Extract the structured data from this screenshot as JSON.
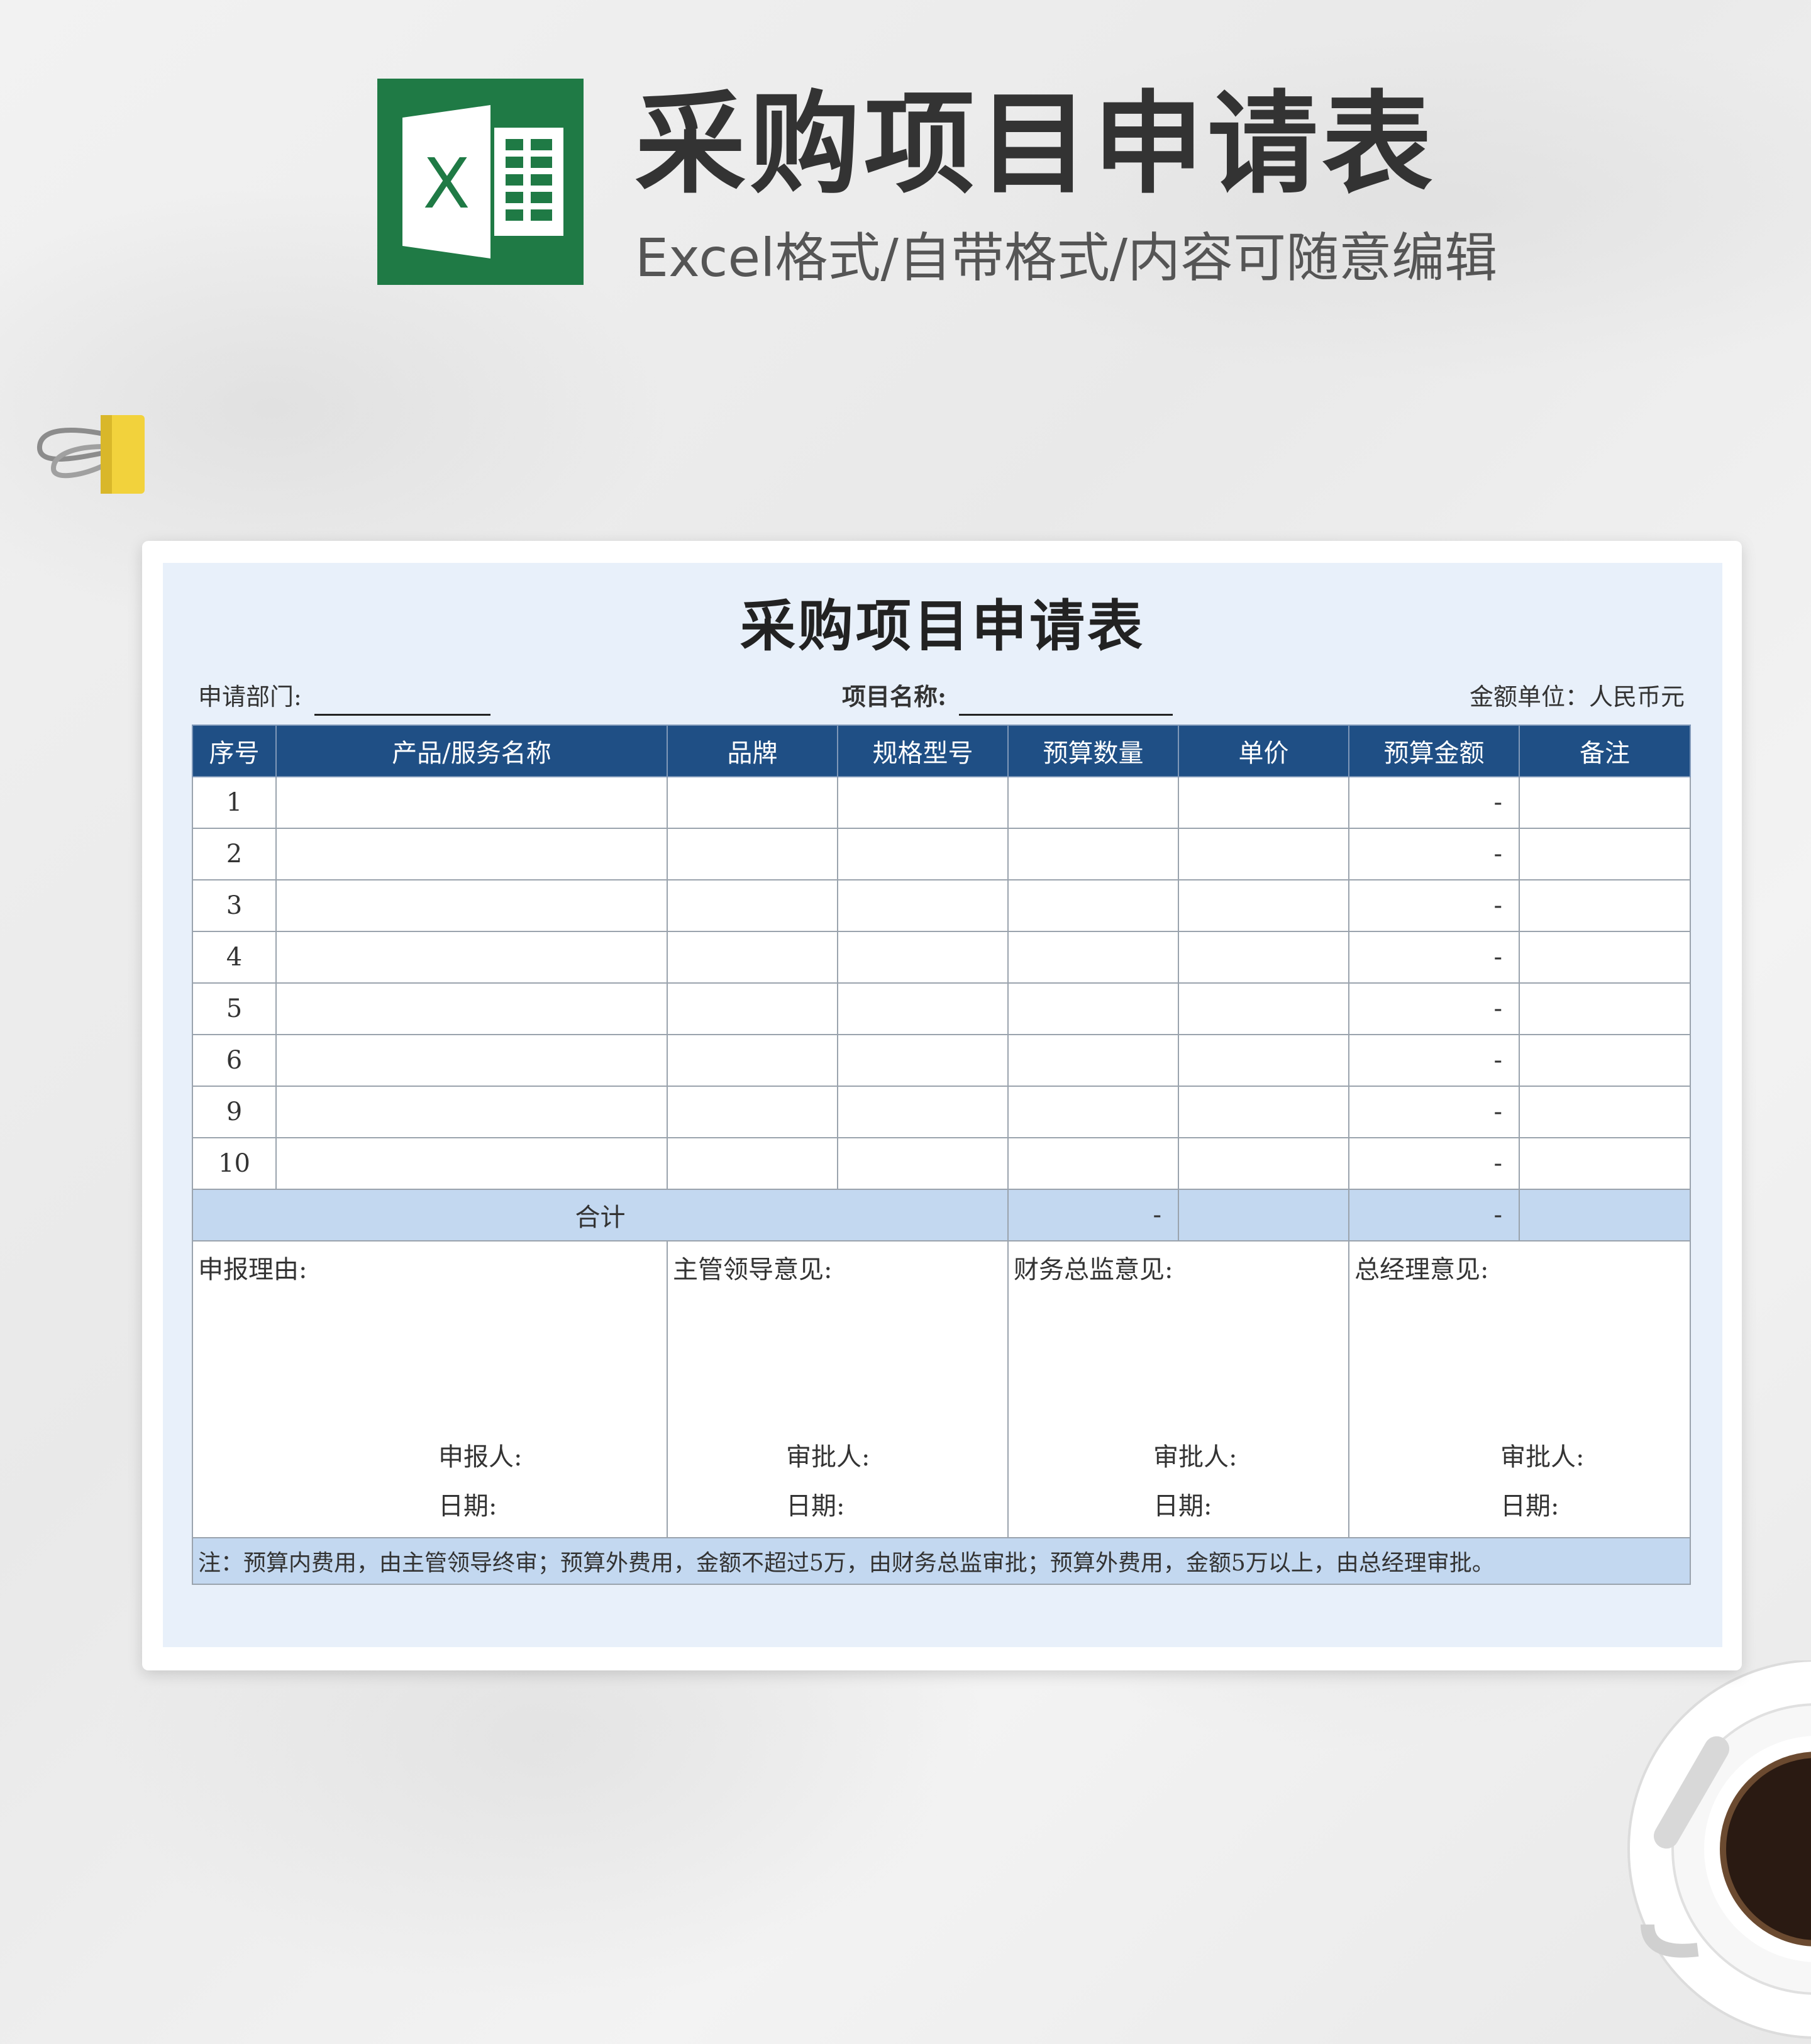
{
  "banner": {
    "logo_icon": "excel-icon",
    "logo_letter": "X",
    "title": "采购项目申请表",
    "subtitle": "Excel格式/自带格式/内容可随意编辑"
  },
  "form": {
    "title": "采购项目申请表",
    "dept_label": "申请部门:",
    "project_label": "项目名称:",
    "unit_label": "金额单位：人民币元"
  },
  "table": {
    "headers": [
      "序号",
      "产品/服务名称",
      "品牌",
      "规格型号",
      "预算数量",
      "单价",
      "预算金额",
      "备注"
    ],
    "rows": [
      {
        "no": "1",
        "amount": "-"
      },
      {
        "no": "2",
        "amount": "-"
      },
      {
        "no": "3",
        "amount": "-"
      },
      {
        "no": "4",
        "amount": "-"
      },
      {
        "no": "5",
        "amount": "-"
      },
      {
        "no": "6",
        "amount": "-"
      },
      {
        "no": "9",
        "amount": "-"
      },
      {
        "no": "10",
        "amount": "-"
      }
    ],
    "total": {
      "label": "合计",
      "qty": "-",
      "amount": "-"
    }
  },
  "opinions": [
    {
      "label": "申报理由:",
      "sign": "申报人:",
      "date": "日期:"
    },
    {
      "label": "主管领导意见:",
      "sign": "审批人:",
      "date": "日期:"
    },
    {
      "label": "财务总监意见:",
      "sign": "审批人:",
      "date": "日期:"
    },
    {
      "label": "总经理意见:",
      "sign": "审批人:",
      "date": "日期:"
    }
  ],
  "note": "注：预算内费用，由主管领导终审；预算外费用，金额不超过5万，由财务总监审批；预算外费用，金额5万以上，由总经理审批。",
  "colors": {
    "excel_green": "#1f7a45",
    "header_blue": "#1f4f85",
    "sheet_bg": "#e8f0fa",
    "total_bg": "#c3d8f0"
  },
  "decor": {
    "clip_icon": "binder-clip-icon",
    "cup_icon": "coffee-cup-icon"
  }
}
